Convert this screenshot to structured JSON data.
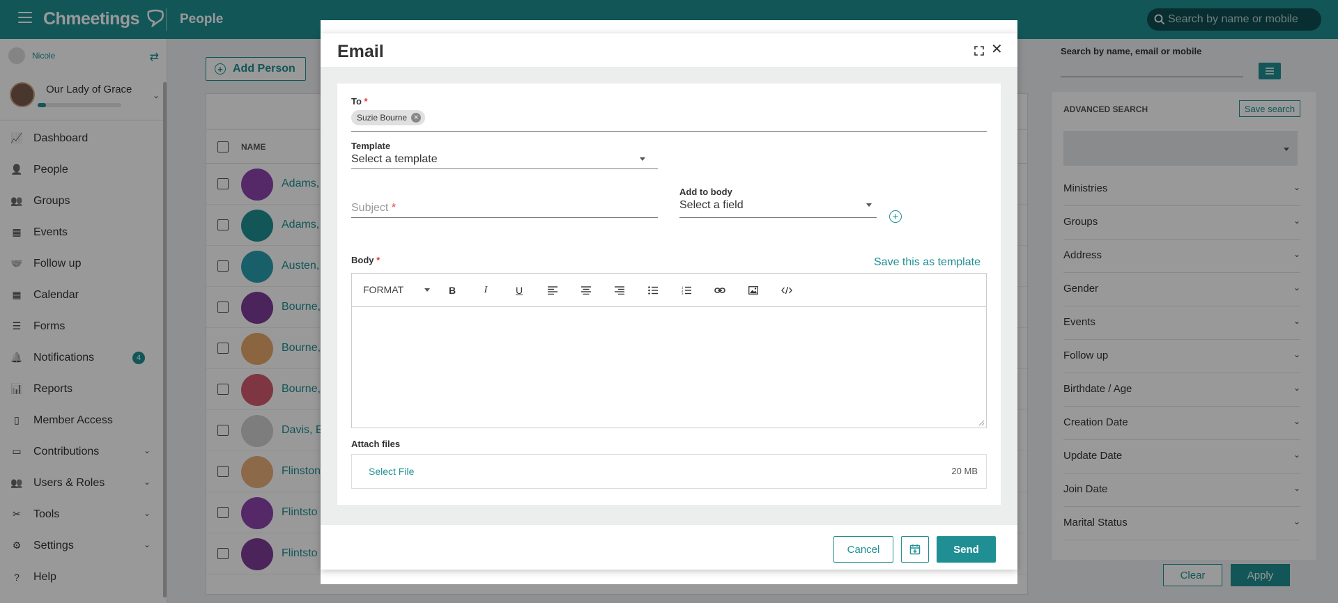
{
  "topbar": {
    "logo": "Chmeetings",
    "page_title": "People",
    "search_placeholder": "Search by name or mobile"
  },
  "sidebar": {
    "user_name": "Nicole",
    "church_name": "Our Lady of Grace",
    "church_progress": 0.1,
    "items": [
      {
        "label": "Dashboard",
        "icon": "dashboard-icon"
      },
      {
        "label": "People",
        "icon": "person-icon"
      },
      {
        "label": "Groups",
        "icon": "groups-icon"
      },
      {
        "label": "Events",
        "icon": "calendar-icon"
      },
      {
        "label": "Follow up",
        "icon": "handshake-icon"
      },
      {
        "label": "Calendar",
        "icon": "calendar-grid-icon"
      },
      {
        "label": "Forms",
        "icon": "list-icon"
      },
      {
        "label": "Notifications",
        "icon": "bell-icon",
        "badge": "4"
      },
      {
        "label": "Reports",
        "icon": "bar-chart-icon"
      },
      {
        "label": "Member Access",
        "icon": "mobile-icon"
      },
      {
        "label": "Contributions",
        "icon": "money-icon",
        "expandable": true
      },
      {
        "label": "Users & Roles",
        "icon": "users-icon",
        "expandable": true
      },
      {
        "label": "Tools",
        "icon": "tools-icon",
        "expandable": true
      },
      {
        "label": "Settings",
        "icon": "gear-icon",
        "expandable": true
      },
      {
        "label": "Help",
        "icon": "help-icon"
      }
    ]
  },
  "main": {
    "add_person_label": "Add Person",
    "column_name": "NAME",
    "rows": [
      {
        "name": "Adams,",
        "color": "#8e44ad"
      },
      {
        "name": "Adams,",
        "color": "#1f8f93"
      },
      {
        "name": "Austen,",
        "color": "#2a9fb0"
      },
      {
        "name": "Bourne,",
        "color": "#7d3c98"
      },
      {
        "name": "Bourne,",
        "color": "#e8a86a"
      },
      {
        "name": "Bourne,",
        "color": "#d35d6e"
      },
      {
        "name": "Davis, E",
        "color": "#d0d0d0"
      },
      {
        "name": "Flinston",
        "color": "#e8b07a"
      },
      {
        "name": "Flintsto",
        "color": "#8e44ad"
      },
      {
        "name": "Flintsto",
        "color": "#7d3c98"
      }
    ]
  },
  "right_panel": {
    "search_label": "Search by name, email or mobile",
    "advanced_title": "ADVANCED SEARCH",
    "save_search_label": "Save search",
    "filters": [
      "Ministries",
      "Groups",
      "Address",
      "Gender",
      "Events",
      "Follow up",
      "Birthdate / Age",
      "Creation Date",
      "Update Date",
      "Join Date",
      "Marital Status"
    ],
    "clear_label": "Clear",
    "apply_label": "Apply"
  },
  "email_modal": {
    "title": "Email",
    "to_label": "To",
    "recipient": "Suzie Bourne",
    "template_label": "Template",
    "template_placeholder": "Select a template",
    "subject_placeholder": "Subject",
    "add_to_body_label": "Add to body",
    "add_to_body_placeholder": "Select a field",
    "body_label": "Body",
    "save_template_label": "Save this as template",
    "format_label": "FORMAT",
    "attach_label": "Attach files",
    "select_file_label": "Select File",
    "max_size": "20 MB",
    "cancel_label": "Cancel",
    "send_label": "Send"
  },
  "colors": {
    "brand": "#1f8f93",
    "brand_dark": "#0e4e52",
    "required": "#e53935"
  }
}
